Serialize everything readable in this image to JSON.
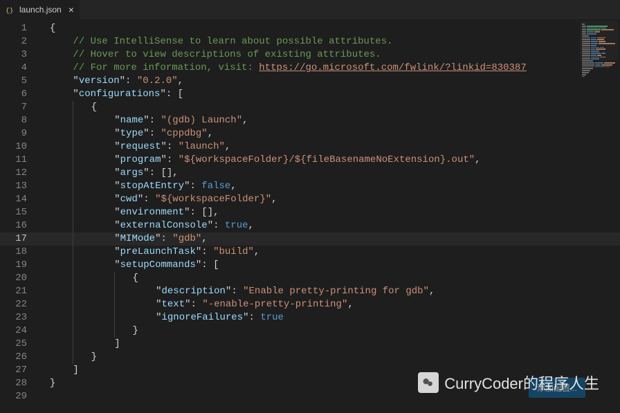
{
  "tab": {
    "filename": "launch.json",
    "close_glyph": "×"
  },
  "gutter": {
    "count": 29,
    "active": 17
  },
  "code": {
    "comment1": "// Use IntelliSense to learn about possible attributes.",
    "comment2": "// Hover to view descriptions of existing attributes.",
    "comment3_prefix": "// For more information, visit: ",
    "comment3_link": "https://go.microsoft.com/fwlink/?linkid=830387",
    "version_key": "version",
    "version_val": "0.2.0",
    "configs_key": "configurations",
    "name_key": "name",
    "name_val": "(gdb) Launch",
    "type_key": "type",
    "type_val": "cppdbg",
    "request_key": "request",
    "request_val": "launch",
    "program_key": "program",
    "program_val": "${workspaceFolder}/${fileBasenameNoExtension}.out",
    "args_key": "args",
    "stopAtEntry_key": "stopAtEntry",
    "stopAtEntry_val": "false",
    "cwd_key": "cwd",
    "cwd_val": "${workspaceFolder}",
    "environment_key": "environment",
    "externalConsole_key": "externalConsole",
    "externalConsole_val": "true",
    "MIMode_key": "MIMode",
    "MIMode_val": "gdb",
    "preLaunchTask_key": "preLaunchTask",
    "preLaunchTask_val": "build",
    "setupCommands_key": "setupCommands",
    "description_key": "description",
    "description_val": "Enable pretty-printing for gdb",
    "text_key": "text",
    "text_val": "-enable-pretty-printing",
    "ignoreFailures_key": "ignoreFailures",
    "ignoreFailures_val": "true"
  },
  "button": {
    "label": "添加配置..."
  },
  "watermark": {
    "text": "CurryCoder的程序人生"
  }
}
